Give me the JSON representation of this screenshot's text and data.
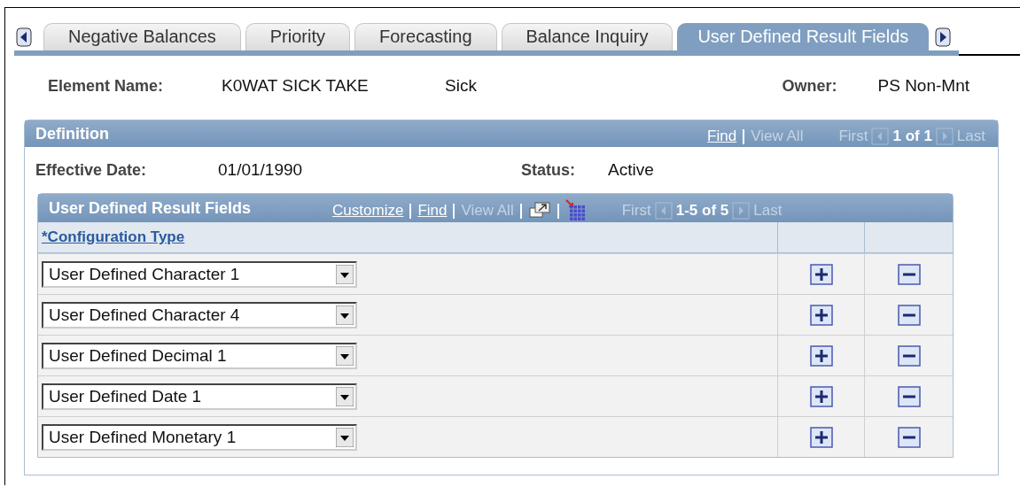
{
  "tabs": [
    {
      "label": "Negative Balances",
      "selected": false
    },
    {
      "label": "Priority",
      "selected": false
    },
    {
      "label": "Forecasting",
      "selected": false
    },
    {
      "label": "Balance Inquiry",
      "selected": false
    },
    {
      "label": "User Defined Result Fields",
      "selected": true
    }
  ],
  "header_fields": [
    {
      "label": "Element Name:",
      "value": "K0WAT SICK TAKE",
      "extra": "Sick"
    },
    {
      "label": "Owner:",
      "value": "PS Non-Mnt"
    }
  ],
  "definition": {
    "title": "Definition",
    "nav": {
      "find": "Find",
      "view_all": "View All",
      "first": "First",
      "count": "1 of 1",
      "last": "Last"
    },
    "effective_date": {
      "label": "Effective Date:",
      "value": "01/01/1990"
    },
    "status": {
      "label": "Status:",
      "value": "Active"
    },
    "grid": {
      "title": "User Defined Result Fields",
      "nav": {
        "customize": "Customize",
        "find": "Find",
        "view_all": "View All",
        "first": "First",
        "count": "1-5 of 5",
        "last": "Last"
      },
      "column": "*Configuration Type",
      "rows": [
        {
          "value": "User Defined Character 1"
        },
        {
          "value": "User Defined Character 4"
        },
        {
          "value": "User Defined Decimal 1"
        },
        {
          "value": "User Defined Date 1"
        },
        {
          "value": "User Defined Monetary 1"
        }
      ]
    }
  }
}
